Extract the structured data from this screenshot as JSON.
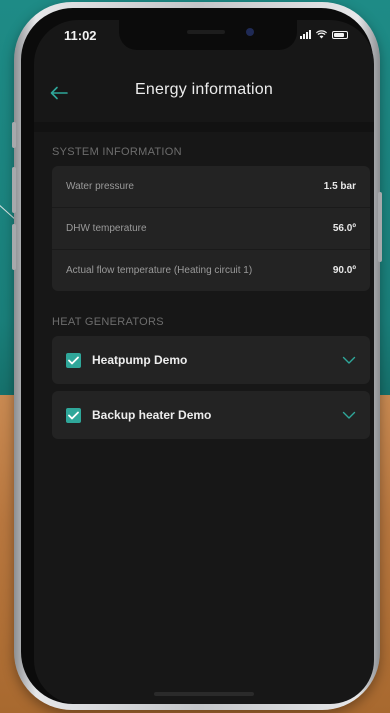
{
  "status_bar": {
    "time": "11:02"
  },
  "header": {
    "title": "Energy information",
    "back_icon": "arrow-left-icon"
  },
  "system_information": {
    "label": "SYSTEM INFORMATION",
    "rows": [
      {
        "label": "Water pressure",
        "value": "1.5 bar"
      },
      {
        "label": "DHW temperature",
        "value": "56.0º"
      },
      {
        "label": "Actual flow temperature (Heating circuit 1)",
        "value": "90.0º"
      }
    ]
  },
  "heat_generators": {
    "label": "HEAT GENERATORS",
    "items": [
      {
        "label": "Heatpump Demo",
        "checked": true
      },
      {
        "label": "Backup heater Demo",
        "checked": true
      }
    ]
  },
  "colors": {
    "accent": "#2fa79a",
    "screen_background": "#171717",
    "card_background": "#232323"
  }
}
